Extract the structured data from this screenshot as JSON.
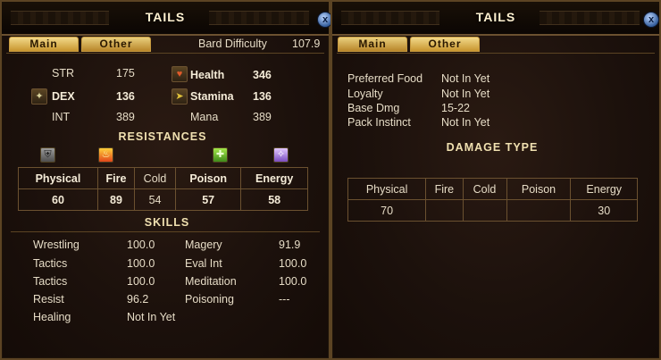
{
  "left": {
    "title": "TAILS",
    "close_glyph": "x",
    "tabs": {
      "main": "Main",
      "other": "Other"
    },
    "bard_label": "Bard Difficulty",
    "bard_value": "107.9",
    "stats": {
      "str_label": "STR",
      "str_value": "175",
      "health_label": "Health",
      "health_value": "346",
      "dex_label": "DEX",
      "dex_value": "136",
      "stamina_label": "Stamina",
      "stamina_value": "136",
      "int_label": "INT",
      "int_value": "389",
      "mana_label": "Mana",
      "mana_value": "389"
    },
    "resistances_heading": "RESISTANCES",
    "resistances": [
      {
        "name": "Physical",
        "value": "60",
        "icon": "shield-icon"
      },
      {
        "name": "Fire",
        "value": "89",
        "icon": "flame-icon"
      },
      {
        "name": "Cold",
        "value": "54",
        "icon": "snowflake-icon"
      },
      {
        "name": "Poison",
        "value": "57",
        "icon": "poison-icon"
      },
      {
        "name": "Energy",
        "value": "58",
        "icon": "energy-icon"
      }
    ],
    "skills_heading": "SKILLS",
    "skills_left": [
      {
        "name": "Wrestling",
        "value": "100.0"
      },
      {
        "name": "Tactics",
        "value": "100.0"
      },
      {
        "name": "Tactics",
        "value": "100.0"
      },
      {
        "name": "Resist",
        "value": "96.2"
      },
      {
        "name": "Healing",
        "value": "Not In Yet"
      }
    ],
    "skills_right": [
      {
        "name": "Magery",
        "value": "91.9"
      },
      {
        "name": "Eval Int",
        "value": "100.0"
      },
      {
        "name": "Meditation",
        "value": "100.0"
      },
      {
        "name": "Poisoning",
        "value": "---"
      }
    ]
  },
  "right": {
    "title": "TAILS",
    "close_glyph": "x",
    "tabs": {
      "main": "Main",
      "other": "Other"
    },
    "info": [
      {
        "label": "Preferred Food",
        "value": "Not In Yet"
      },
      {
        "label": "Loyalty",
        "value": "Not In Yet"
      },
      {
        "label": "Base Dmg",
        "value": "15-22"
      },
      {
        "label": "Pack Instinct",
        "value": "Not In Yet"
      }
    ],
    "damage_heading": "DAMAGE TYPE",
    "damage": [
      {
        "name": "Physical",
        "value": "70"
      },
      {
        "name": "Fire",
        "value": ""
      },
      {
        "name": "Cold",
        "value": ""
      },
      {
        "name": "Poison",
        "value": ""
      },
      {
        "name": "Energy",
        "value": "30"
      }
    ]
  },
  "colors": {
    "accent_gold": "#c8962f",
    "border": "#6b5130",
    "text": "#e6dcc6"
  }
}
